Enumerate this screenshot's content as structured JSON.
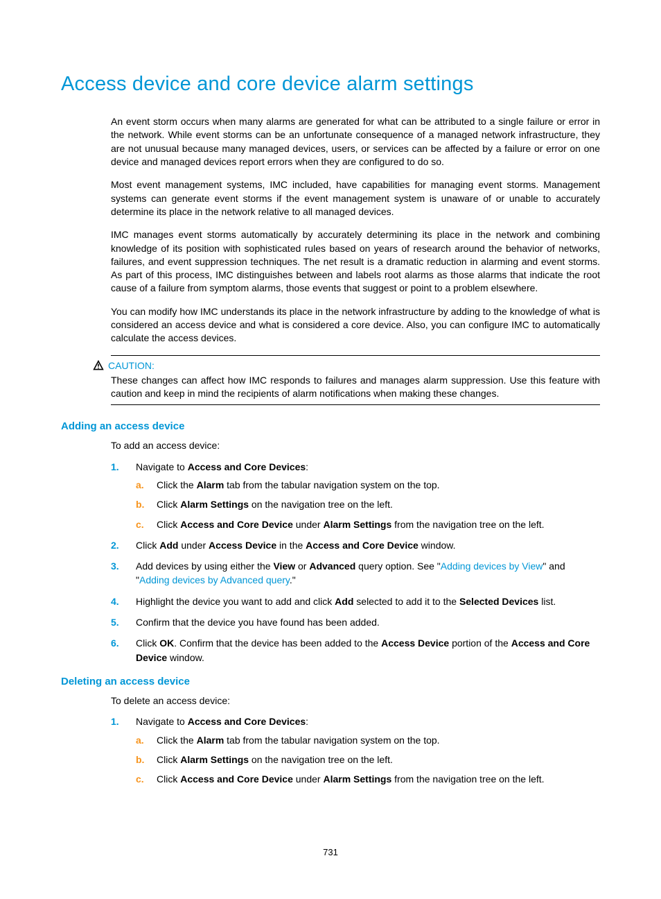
{
  "title": "Access device and core device alarm settings",
  "paras": [
    "An event storm occurs when many alarms are generated for what can be attributed to a single failure or error in the network. While event storms can be an unfortunate consequence of a managed network infrastructure, they are not unusual because many managed devices, users, or services can be affected by a failure or error on one device and managed devices report errors when they are configured to do so.",
    "Most event management systems, IMC included, have capabilities for managing event storms. Management systems can generate event storms if the event management system is unaware of or unable to accurately determine its place in the network relative to all managed devices.",
    "IMC manages event storms automatically by accurately determining its place in the network and combining knowledge of its position with sophisticated rules based on years of research around the behavior of networks, failures, and event suppression techniques. The net result is a dramatic reduction in alarming and event storms. As part of this process, IMC distinguishes between and labels root alarms as those alarms that indicate the root cause of a failure from symptom alarms, those events that suggest or point to a problem elsewhere.",
    "You can modify how IMC understands its place in the network infrastructure by adding to the knowledge of what is considered an access device and what is considered a core device. Also, you can configure IMC to automatically calculate the access devices."
  ],
  "caution": {
    "label": "CAUTION:",
    "text": "These changes can affect how IMC responds to failures and manages alarm suppression. Use this feature with caution and keep in mind the recipients of alarm notifications when making these changes."
  },
  "section_add": {
    "heading": "Adding an access device",
    "intro": "To add an access device:",
    "steps": {
      "s1": {
        "m": "1.",
        "pre": "Navigate to ",
        "bold": "Access and Core Devices",
        "post": ":"
      },
      "s1a": {
        "m": "a.",
        "t1": "Click the ",
        "b1": "Alarm",
        "t2": " tab from the tabular navigation system on the top."
      },
      "s1b": {
        "m": "b.",
        "t1": "Click ",
        "b1": "Alarm Settings",
        "t2": " on the navigation tree on the left."
      },
      "s1c": {
        "m": "c.",
        "t1": "Click ",
        "b1": "Access and Core Device",
        "t2": " under ",
        "b2": "Alarm Settings",
        "t3": " from the navigation tree on the left."
      },
      "s2": {
        "m": "2.",
        "t1": "Click ",
        "b1": "Add",
        "t2": " under ",
        "b2": "Access Device",
        "t3": " in the ",
        "b3": "Access and Core Device",
        "t4": " window."
      },
      "s3": {
        "m": "3.",
        "t1": "Add devices by using either the ",
        "b1": "View",
        "t2": " or ",
        "b2": "Advanced",
        "t3": " query option. See \"",
        "l1": "Adding devices by View",
        "t4": "\" and \"",
        "l2": "Adding devices by Advanced query",
        "t5": ".\""
      },
      "s4": {
        "m": "4.",
        "t1": "Highlight the device you want to add and click ",
        "b1": "Add",
        "t2": " selected to add it to the ",
        "b2": "Selected Devices",
        "t3": " list."
      },
      "s5": {
        "m": "5.",
        "t1": "Confirm that the device you have found has been added."
      },
      "s6": {
        "m": "6.",
        "t1": "Click ",
        "b1": "OK",
        "t2": ". Confirm that the device has been added to the ",
        "b2": "Access Device",
        "t3": " portion of the ",
        "b3": "Access and Core Device",
        "t4": " window."
      }
    }
  },
  "section_del": {
    "heading": "Deleting an access device",
    "intro": "To delete an access device:",
    "steps": {
      "s1": {
        "m": "1.",
        "pre": "Navigate to ",
        "bold": "Access and Core Devices",
        "post": ":"
      },
      "s1a": {
        "m": "a.",
        "t1": "Click the ",
        "b1": "Alarm",
        "t2": " tab from the tabular navigation system on the top."
      },
      "s1b": {
        "m": "b.",
        "t1": "Click ",
        "b1": "Alarm Settings",
        "t2": " on the navigation tree on the left."
      },
      "s1c": {
        "m": "c.",
        "t1": "Click ",
        "b1": "Access and Core Device",
        "t2": " under ",
        "b2": "Alarm Settings",
        "t3": " from the navigation tree on the left."
      }
    }
  },
  "page_number": "731"
}
